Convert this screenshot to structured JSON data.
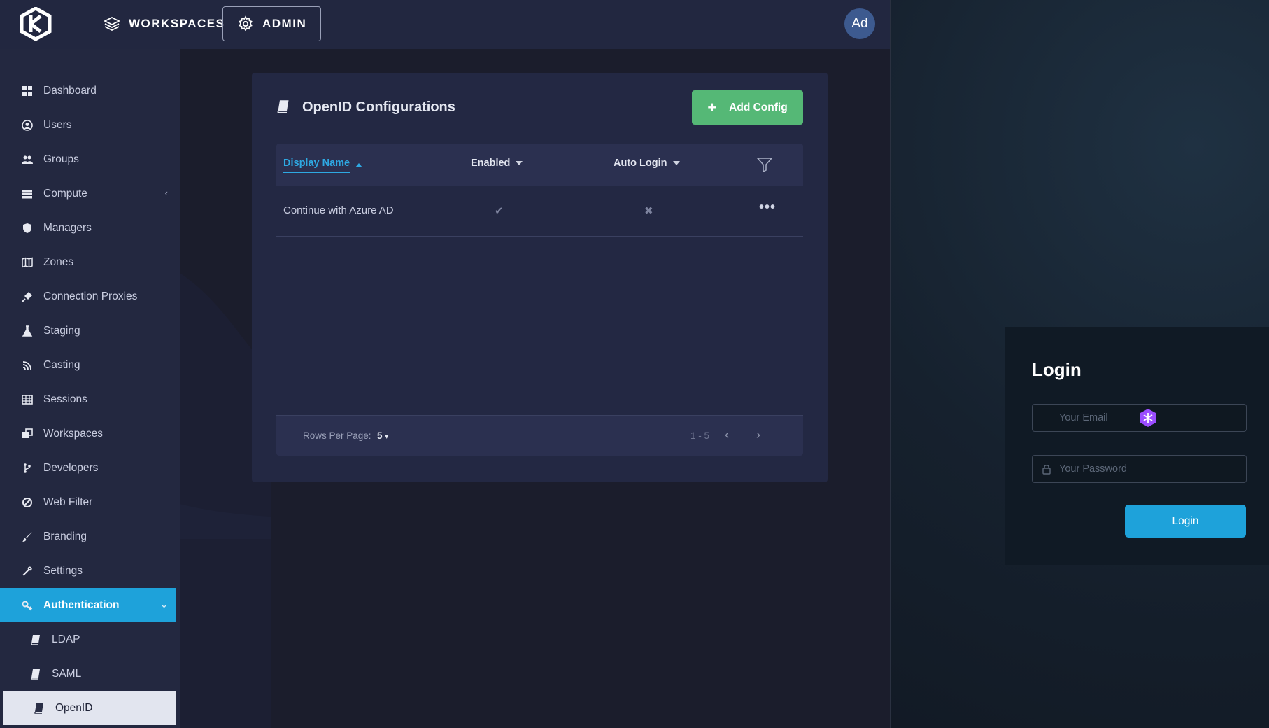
{
  "topbar": {
    "workspaces_label": "WORKSPACES",
    "admin_label": "ADMIN",
    "avatar_initials": "Ad"
  },
  "sidebar": {
    "items": [
      {
        "label": "Dashboard",
        "icon": "dashboard-icon"
      },
      {
        "label": "Users",
        "icon": "user-circle-icon"
      },
      {
        "label": "Groups",
        "icon": "users-icon"
      },
      {
        "label": "Compute",
        "icon": "server-icon"
      },
      {
        "label": "Managers",
        "icon": "shield-icon"
      },
      {
        "label": "Zones",
        "icon": "map-icon"
      },
      {
        "label": "Connection Proxies",
        "icon": "plug-icon"
      },
      {
        "label": "Staging",
        "icon": "flask-icon"
      },
      {
        "label": "Casting",
        "icon": "casting-icon"
      },
      {
        "label": "Sessions",
        "icon": "table-icon"
      },
      {
        "label": "Workspaces",
        "icon": "clone-icon"
      },
      {
        "label": "Developers",
        "icon": "code-branch-icon"
      },
      {
        "label": "Web Filter",
        "icon": "ban-icon"
      },
      {
        "label": "Branding",
        "icon": "brush-icon"
      },
      {
        "label": "Settings",
        "icon": "wrench-icon"
      },
      {
        "label": "Authentication",
        "icon": "key-icon"
      },
      {
        "label": "LDAP",
        "icon": "book-icon"
      },
      {
        "label": "SAML",
        "icon": "book-icon"
      },
      {
        "label": "OpenID",
        "icon": "book-icon"
      }
    ]
  },
  "main": {
    "title": "OpenID Configurations",
    "add_button_label": "Add Config",
    "columns": [
      "Display Name",
      "Enabled",
      "Auto Login"
    ],
    "rows": [
      {
        "display_name": "Continue with Azure AD",
        "enabled": "✔",
        "auto_login": "✖",
        "actions": "•••"
      }
    ],
    "footer": {
      "rows_per_page_label": "Rows Per Page:",
      "rows_per_page_value": "5",
      "page_range": "1 - 5"
    }
  },
  "login": {
    "title": "Login",
    "email_placeholder": "Your Email",
    "password_placeholder": "Your Password",
    "button_label": "Login"
  },
  "colors": {
    "accent": "#1ea2da",
    "add_button": "#55b876",
    "sidebar_bg": "#232840",
    "topbar_bg": "#222740",
    "card_bg": "#232843"
  }
}
